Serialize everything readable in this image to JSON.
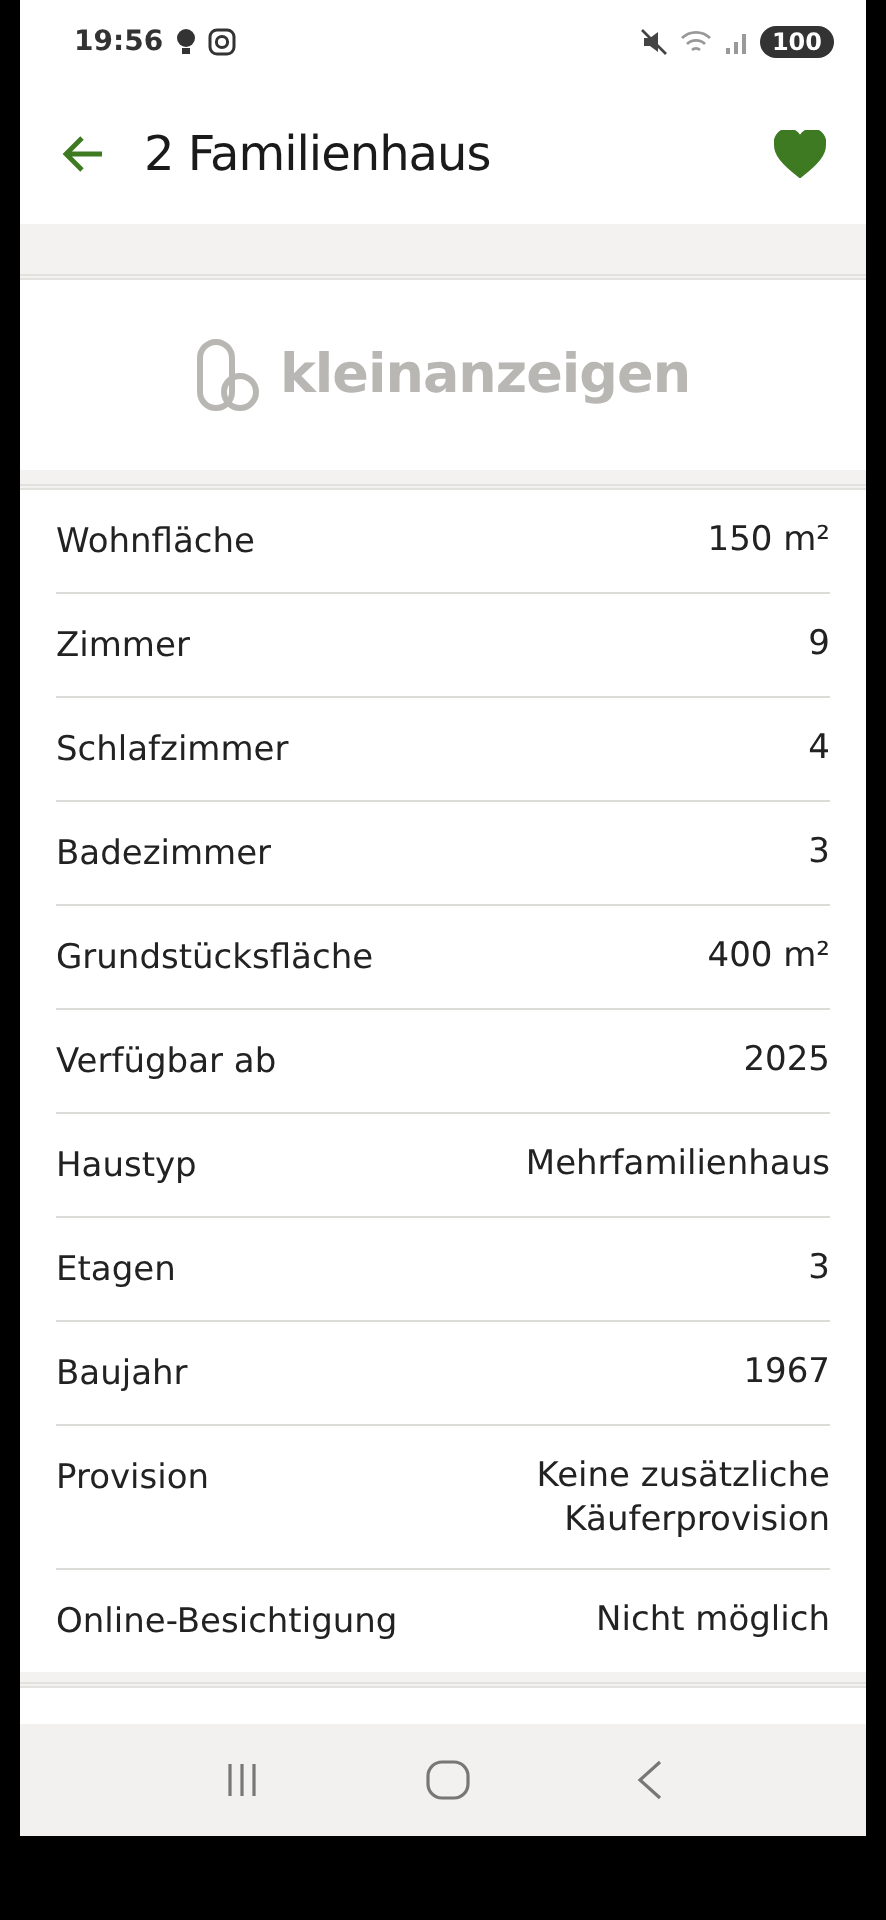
{
  "status_bar": {
    "time": "19:56",
    "battery": "100"
  },
  "header": {
    "title": "2 Familienhaus",
    "favorite": true
  },
  "brand": {
    "name": "kleinanzeigen"
  },
  "details": [
    {
      "label": "Wohnfläche",
      "value": "150 m²"
    },
    {
      "label": "Zimmer",
      "value": "9"
    },
    {
      "label": "Schlafzimmer",
      "value": "4"
    },
    {
      "label": "Badezimmer",
      "value": "3"
    },
    {
      "label": "Grundstücksfläche",
      "value": "400 m²"
    },
    {
      "label": "Verfügbar ab",
      "value": "2025"
    },
    {
      "label": "Haustyp",
      "value": "Mehrfamilienhaus"
    },
    {
      "label": "Etagen",
      "value": "3"
    },
    {
      "label": "Baujahr",
      "value": "1967"
    },
    {
      "label": "Provision",
      "value": "Keine zusätzliche Käuferprovision"
    },
    {
      "label": "Online-Besichtigung",
      "value": "Nicht möglich"
    }
  ]
}
